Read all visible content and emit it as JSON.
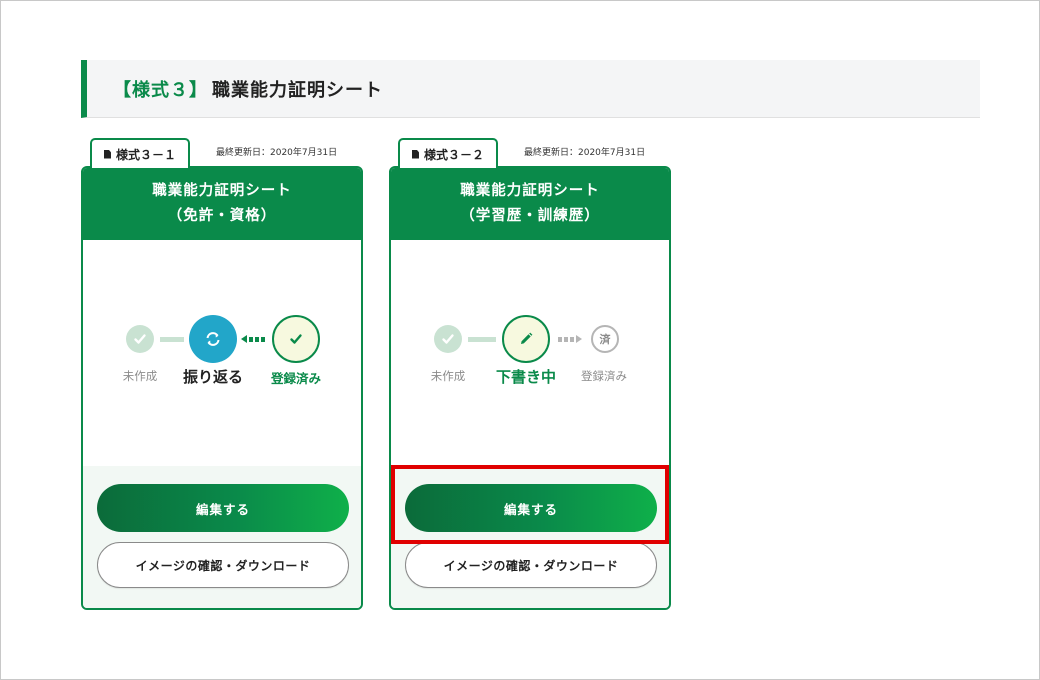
{
  "section": {
    "tag": "【様式３】",
    "title": "職業能力証明シート"
  },
  "cards": [
    {
      "tab_label": "様式３－１",
      "updated": "最終更新日：2020年7月31日",
      "title_line1": "職業能力証明シート",
      "title_line2": "（免許・資格）",
      "steps": {
        "step1_label": "未作成",
        "step2_label": "振り返る",
        "step3_label": "登録済み"
      },
      "edit_label": "編集する",
      "download_label": "イメージの確認・ダウンロード"
    },
    {
      "tab_label": "様式３－２",
      "updated": "最終更新日：2020年7月31日",
      "title_line1": "職業能力証明シート",
      "title_line2": "（学習歴・訓練歴）",
      "steps": {
        "step1_label": "未作成",
        "step2_label": "下書き中",
        "step3_label": "登録済み",
        "step3_icon_text": "済"
      },
      "edit_label": "編集する",
      "download_label": "イメージの確認・ダウンロード"
    }
  ],
  "icons": {
    "check": "check-icon",
    "refresh": "refresh-icon",
    "pencil": "pencil-icon",
    "document": "document-icon"
  },
  "colors": {
    "brand_green": "#0a8a4a",
    "light_green": "#c9e2d2",
    "active_blue": "#22a6c9",
    "highlight_red": "#e00000"
  }
}
